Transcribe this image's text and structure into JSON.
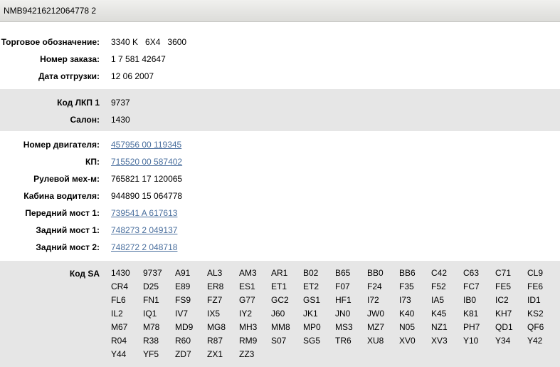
{
  "header": {
    "title": "NMB94216212064778 2"
  },
  "general": [
    {
      "label": "Торговое обозначение:",
      "value": "3340 K   6X4   3600",
      "link": false
    },
    {
      "label": "Номер заказа:",
      "value": "1 7 581 42647",
      "link": false
    },
    {
      "label": "Дата отгрузки:",
      "value": "12 06 2007",
      "link": false
    }
  ],
  "paint": [
    {
      "label": "Код ЛКП 1",
      "value": "9737"
    },
    {
      "label": "Салон:",
      "value": "1430"
    }
  ],
  "aggregates": [
    {
      "label": "Номер двигателя:",
      "value": "457956 00 119345",
      "link": true
    },
    {
      "label": "КП:",
      "value": "715520 00 587402",
      "link": true
    },
    {
      "label": "Рулевой мех-м:",
      "value": "765821 17 120065",
      "link": false
    },
    {
      "label": "Кабина водителя:",
      "value": "944890 15 064778",
      "link": false
    },
    {
      "label": "Передний мост 1:",
      "value": "739541 A 617613",
      "link": true
    },
    {
      "label": "Задний мост 1:",
      "value": "748273 2 049137",
      "link": true
    },
    {
      "label": "Задний мост 2:",
      "value": "748272 2 048718",
      "link": true
    }
  ],
  "sa": {
    "label": "Код SA",
    "codes": [
      "1430",
      "9737",
      "A91",
      "AL3",
      "AM3",
      "AR1",
      "B02",
      "B65",
      "BB0",
      "BB6",
      "C42",
      "C63",
      "C71",
      "CL9",
      "CR4",
      "D25",
      "E89",
      "ER8",
      "ES1",
      "ET1",
      "ET2",
      "F07",
      "F24",
      "F35",
      "F52",
      "FC7",
      "FE5",
      "FE6",
      "FL6",
      "FN1",
      "FS9",
      "FZ7",
      "G77",
      "GC2",
      "GS1",
      "HF1",
      "I72",
      "I73",
      "IA5",
      "IB0",
      "IC2",
      "ID1",
      "IL2",
      "IQ1",
      "IV7",
      "IX5",
      "IY2",
      "J60",
      "JK1",
      "JN0",
      "JW0",
      "K40",
      "K45",
      "K81",
      "KH7",
      "KS2",
      "M67",
      "M78",
      "MD9",
      "MG8",
      "MH3",
      "MM8",
      "MP0",
      "MS3",
      "MZ7",
      "N05",
      "NZ1",
      "PH7",
      "QD1",
      "QF6",
      "R04",
      "R38",
      "R60",
      "R87",
      "RM9",
      "S07",
      "SG5",
      "TR6",
      "XU8",
      "XV0",
      "XV3",
      "Y10",
      "Y34",
      "Y42",
      "Y44",
      "YF5",
      "ZD7",
      "ZX1",
      "ZZ3"
    ]
  }
}
